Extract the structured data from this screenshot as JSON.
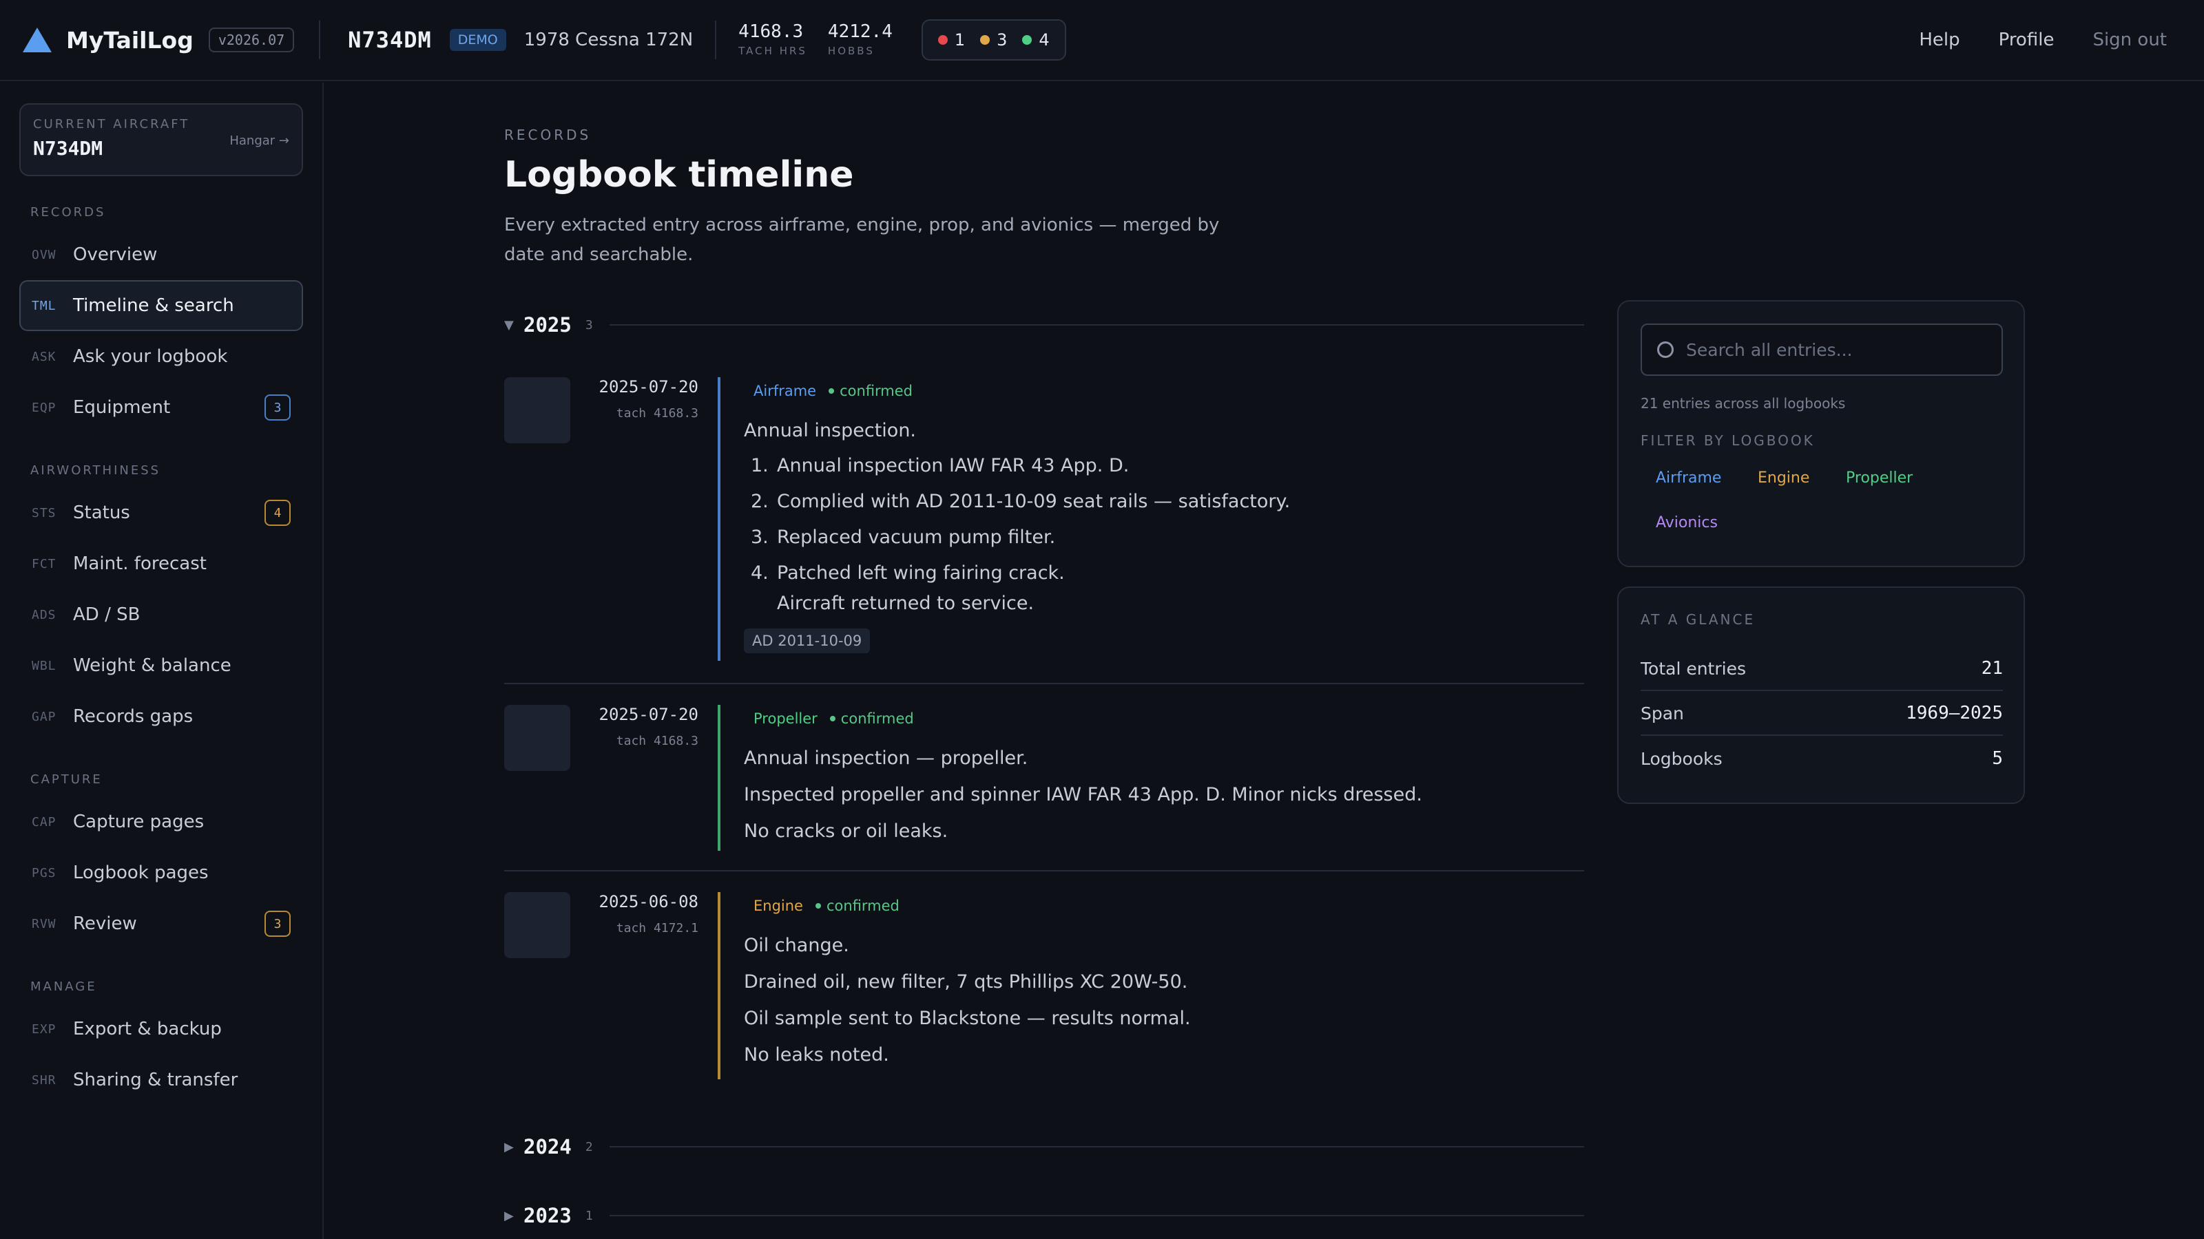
{
  "app": {
    "name": "MyTailLog",
    "version": "v2026.07",
    "tail": "N734DM",
    "demo": "DEMO",
    "model": "1978 Cessna 172N",
    "tach_value": "4168.3",
    "tach_label": "TACH HRS",
    "hobbs_value": "4212.4",
    "hobbs_label": "HOBBS",
    "status": {
      "red": "1",
      "amber": "3",
      "green": "4"
    },
    "links": {
      "help": "Help",
      "profile": "Profile",
      "signout": "Sign out"
    }
  },
  "colors": {
    "airframe": "#5b9ef0",
    "engine": "#e0a84a",
    "propeller": "#4fcf86",
    "avionics": "#b788f2",
    "status_red": "#e5484d",
    "status_amber": "#e0a84a",
    "status_green": "#4fcf86"
  },
  "sidebar": {
    "current_label": "CURRENT AIRCRAFT",
    "current_tail": "N734DM",
    "hangar_link": "Hangar →",
    "sections": {
      "records": "RECORDS",
      "airworthiness": "AIRWORTHINESS",
      "capture": "CAPTURE",
      "manage": "MANAGE"
    },
    "items": [
      {
        "code": "OVW",
        "label": "Overview"
      },
      {
        "code": "TML",
        "label": "Timeline & search"
      },
      {
        "code": "ASK",
        "label": "Ask your logbook"
      },
      {
        "code": "EQP",
        "label": "Equipment",
        "badge": "3"
      },
      {
        "code": "STS",
        "label": "Status",
        "badge": "4"
      },
      {
        "code": "FCT",
        "label": "Maint. forecast"
      },
      {
        "code": "ADS",
        "label": "AD / SB"
      },
      {
        "code": "WBL",
        "label": "Weight & balance"
      },
      {
        "code": "GAP",
        "label": "Records gaps"
      },
      {
        "code": "CAP",
        "label": "Capture pages"
      },
      {
        "code": "PGS",
        "label": "Logbook pages"
      },
      {
        "code": "RVW",
        "label": "Review",
        "badge": "3"
      },
      {
        "code": "EXP",
        "label": "Export & backup"
      },
      {
        "code": "SHR",
        "label": "Sharing & transfer"
      }
    ]
  },
  "main": {
    "kicker": "RECORDS",
    "title": "Logbook timeline",
    "description": "Every extracted entry across airframe, engine, prop, and avionics — merged by date and searchable.",
    "years": [
      {
        "year": "2025",
        "count": "3",
        "expanded": true
      },
      {
        "year": "2024",
        "count": "2",
        "expanded": false
      },
      {
        "year": "2023",
        "count": "1",
        "expanded": false
      }
    ],
    "entries": [
      {
        "date": "2025-07-20",
        "tach": "tach 4168.3",
        "logbook": "Airframe",
        "status": "confirmed",
        "title": "Annual inspection.",
        "list": [
          {
            "num": "1.",
            "text": "Annual inspection IAW FAR 43 App. D."
          },
          {
            "num": "2.",
            "text": "Complied with AD 2011-10-09 seat rails — satisfactory."
          },
          {
            "num": "3.",
            "text": "Replaced vacuum pump filter."
          },
          {
            "num": "4.",
            "text": "Patched left wing fairing crack.",
            "cont": "Aircraft returned to service."
          }
        ],
        "chip": "AD 2011-10-09"
      },
      {
        "date": "2025-07-20",
        "tach": "tach 4168.3",
        "logbook": "Propeller",
        "status": "confirmed",
        "lines": [
          "Annual inspection — propeller.",
          "Inspected propeller and spinner IAW FAR 43 App. D. Minor nicks dressed.",
          "No cracks or oil leaks."
        ]
      },
      {
        "date": "2025-06-08",
        "tach": "tach 4172.1",
        "logbook": "Engine",
        "status": "confirmed",
        "lines": [
          "Oil change.",
          "Drained oil, new filter, 7 qts Phillips XC 20W-50.",
          "Oil sample sent to Blackstone — results normal.",
          "No leaks noted."
        ]
      }
    ]
  },
  "panel": {
    "search_placeholder": "Search all entries...",
    "entry_count": "21 entries across all logbooks",
    "filter_label": "FILTER BY LOGBOOK",
    "filters": [
      "Airframe",
      "Engine",
      "Propeller",
      "Avionics"
    ],
    "glance_label": "AT A GLANCE",
    "glance": [
      {
        "key": "Total entries",
        "value": "21"
      },
      {
        "key": "Span",
        "value": "1969–2025"
      },
      {
        "key": "Logbooks",
        "value": "5"
      }
    ]
  }
}
